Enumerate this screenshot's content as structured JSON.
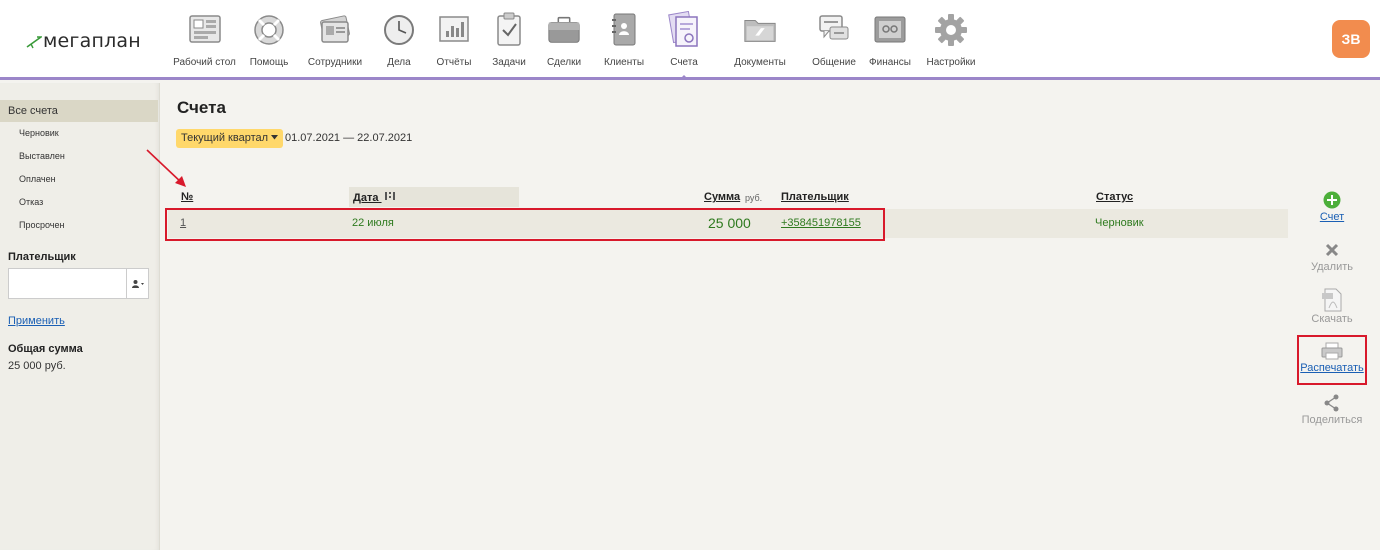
{
  "logo": {
    "text": "мегаплан"
  },
  "nav": [
    {
      "label": "Рабочий стол",
      "icon": "desktop-icon"
    },
    {
      "label": "Помощь",
      "icon": "lifebuoy-icon"
    },
    {
      "label": "Сотрудники",
      "icon": "employees-icon"
    },
    {
      "label": "Дела",
      "icon": "clock-icon"
    },
    {
      "label": "Отчёты",
      "icon": "report-chart-icon"
    },
    {
      "label": "Задачи",
      "icon": "clipboard-check-icon"
    },
    {
      "label": "Сделки",
      "icon": "briefcase-icon"
    },
    {
      "label": "Клиенты",
      "icon": "contact-book-icon"
    },
    {
      "label": "Счета",
      "icon": "invoice-icon",
      "active": true
    },
    {
      "label": "Документы",
      "icon": "folder-icon"
    },
    {
      "label": "Общение",
      "icon": "chat-icon"
    },
    {
      "label": "Финансы",
      "icon": "safe-icon"
    },
    {
      "label": "Настройки",
      "icon": "gear-icon"
    }
  ],
  "user": {
    "initials": "ЗВ"
  },
  "sidebar": {
    "all_label": "Все счета",
    "statuses": [
      "Черновик",
      "Выставлен",
      "Оплачен",
      "Отказ",
      "Просрочен"
    ],
    "payer_heading": "Плательщик",
    "apply_label": "Применить",
    "total_heading": "Общая сумма",
    "total_value": "25 000 руб."
  },
  "main": {
    "title": "Счета",
    "period_label": "Текущий квартал",
    "period_range": "01.07.2021 — 22.07.2021",
    "columns": {
      "number": "№",
      "date": "Дата",
      "sum": "Сумма",
      "sum_unit": "руб.",
      "payer": "Плательщик",
      "status": "Статус"
    },
    "rows": [
      {
        "number": "1",
        "date": "22 июля",
        "sum": "25 000",
        "payer": "+358451978155",
        "status": "Черновик"
      }
    ]
  },
  "toolbar": {
    "add_label": "Счет",
    "delete_label": "Удалить",
    "download_label": "Скачать",
    "print_label": "Распечатать",
    "share_label": "Поделиться"
  },
  "colors": {
    "accent": "#9b86c9",
    "avatar": "#f28c4e",
    "period_highlight": "#ffd86b",
    "row_text": "#2e7a1e",
    "annotation_red": "#d8192b"
  }
}
